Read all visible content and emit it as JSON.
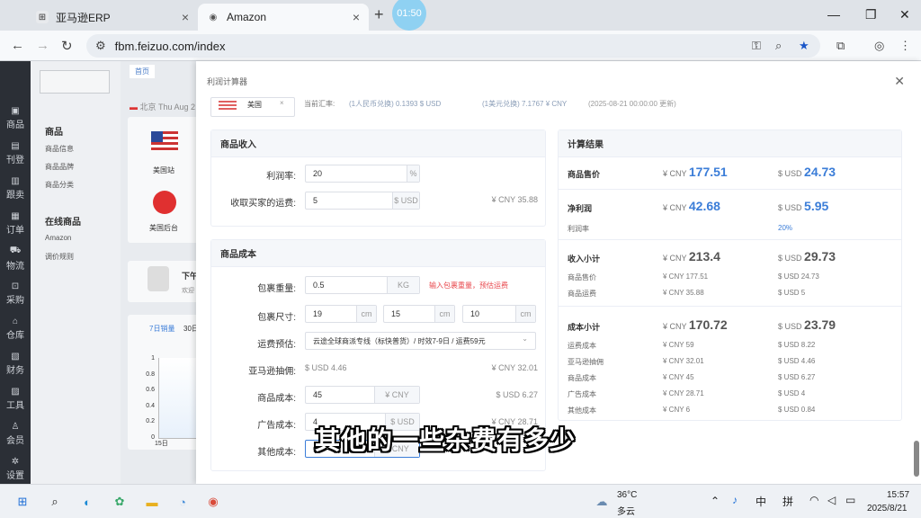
{
  "browser": {
    "tabs": [
      {
        "title": "亚马逊ERP"
      },
      {
        "title": "Amazon"
      }
    ],
    "timer": "01:50",
    "url": "fbm.feizuo.com/index"
  },
  "sidebar": {
    "items": [
      {
        "label": "商品"
      },
      {
        "label": "刊登"
      },
      {
        "label": "跟卖"
      },
      {
        "label": "订单"
      },
      {
        "label": "物流"
      },
      {
        "label": "采购"
      },
      {
        "label": "仓库"
      },
      {
        "label": "财务"
      },
      {
        "label": "工具"
      },
      {
        "label": "会员"
      },
      {
        "label": "设置"
      }
    ]
  },
  "submenu": {
    "group1": "商品",
    "items1": [
      "商品信息",
      "商品品牌",
      "商品分类"
    ],
    "group2": "在线商品",
    "items2": [
      "Amazon",
      "调价规则"
    ]
  },
  "background": {
    "home_tab": "首页",
    "date": "北京 Thu Aug 2",
    "site1": "美国站",
    "site2": "美国后台",
    "sales_tab": "7日销量",
    "sales_tab2": "30日",
    "y_ticks": [
      "1",
      "0.8",
      "0.6",
      "0.4",
      "0.2",
      "0"
    ],
    "x_tick": "15日",
    "greet": "下午",
    "greet2": "欢迎"
  },
  "panel": {
    "title": "利润计算器",
    "toprow": {
      "country": "美国",
      "rate_label": "当前汇率:",
      "rate_text": "(1人民币兑换) 0.1393 $ USD",
      "rate2_text": "(1美元兑换) 7.1767 ¥ CNY",
      "rate_time": "(2025-08-21 00:00:00 更新)"
    },
    "income": {
      "header": "商品收入",
      "margin_label": "利润率:",
      "margin_value": "20",
      "margin_unit": "%",
      "shipping_label": "收取买家的运费:",
      "shipping_value": "5",
      "shipping_unit": "$ USD",
      "shipping_conv": "¥ CNY 35.88"
    },
    "cost": {
      "header": "商品成本",
      "weight_label": "包裹重量:",
      "weight_value": "0.5",
      "weight_unit": "KG",
      "weight_hint": "输入包裹重量，预估运费",
      "size_label": "包裹尺寸:",
      "size_l": "19",
      "size_w": "15",
      "size_h": "10",
      "size_unit": "cm",
      "ship_label": "运费预估:",
      "ship_value": "云途全球商派专线（标快普货）/ 时效7-9日 / 运费59元",
      "commission_label": "亚马逊抽佣:",
      "commission_usd": "$ USD 4.46",
      "commission_cny": "¥ CNY 32.01",
      "product_label": "商品成本:",
      "product_value": "45",
      "product_unit": "¥ CNY",
      "product_conv": "$ USD 6.27",
      "ad_label": "广告成本:",
      "ad_value": "4",
      "ad_unit": "$ USD",
      "ad_conv": "¥ CNY 28.71",
      "other_label": "其他成本:",
      "other_value": "6",
      "other_unit": "¥ CNY"
    },
    "results": {
      "header": "计算结果",
      "price_label": "商品售价",
      "price_cny_prefix": "¥ CNY",
      "price_cny": "177.51",
      "price_usd_prefix": "$ USD",
      "price_usd": "24.73",
      "profit_label": "净利润",
      "profit_cny": "42.68",
      "profit_usd": "5.95",
      "margin_label": "利润率",
      "margin_value": "20%",
      "income_label": "收入小计",
      "income_cny": "213.4",
      "income_usd": "29.73",
      "income_rows": [
        {
          "label": "商品售价",
          "cny": "¥ CNY 177.51",
          "usd": "$ USD 24.73"
        },
        {
          "label": "商品运费",
          "cny": "¥ CNY 35.88",
          "usd": "$ USD 5"
        }
      ],
      "cost_label": "成本小计",
      "cost_cny": "170.72",
      "cost_usd": "23.79",
      "cost_rows": [
        {
          "label": "运费成本",
          "cny": "¥ CNY 59",
          "usd": "$ USD 8.22"
        },
        {
          "label": "亚马逊抽佣",
          "cny": "¥ CNY 32.01",
          "usd": "$ USD 4.46"
        },
        {
          "label": "商品成本",
          "cny": "¥ CNY 45",
          "usd": "$ USD 6.27"
        },
        {
          "label": "广告成本",
          "cny": "¥ CNY 28.71",
          "usd": "$ USD 4"
        },
        {
          "label": "其他成本",
          "cny": "¥ CNY 6",
          "usd": "$ USD 0.84"
        }
      ]
    }
  },
  "caption": "其他的一些杂费有多少",
  "taskbar": {
    "weather_temp": "36°C",
    "weather_desc": "多云",
    "ime1": "中",
    "ime2": "拼",
    "time": "15:57",
    "date": "2025/8/21"
  },
  "colors": {
    "accent": "#3b7dd8",
    "hint_red": "#e8474c",
    "sidebar_bg": "#2b2f36"
  }
}
